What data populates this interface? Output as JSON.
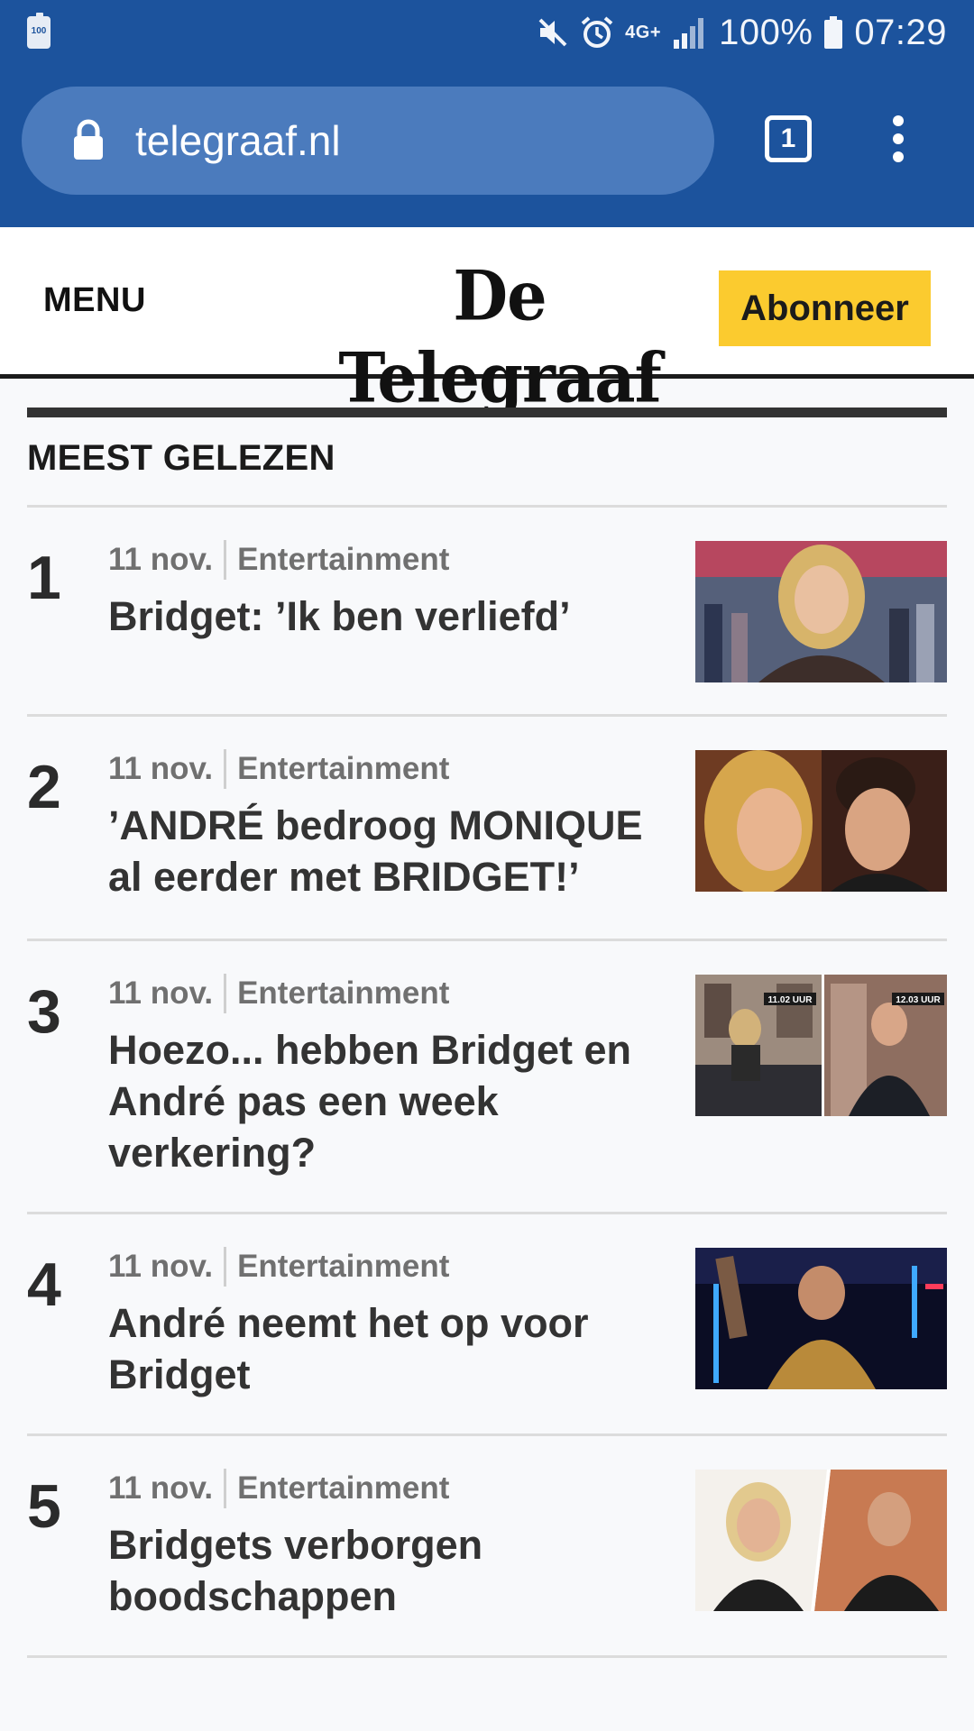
{
  "status_bar": {
    "battery_small": "100",
    "network": "4G+",
    "battery_percent": "100%",
    "time": "07:29"
  },
  "browser": {
    "url": "telegraaf.nl",
    "tab_count": "1"
  },
  "header": {
    "menu_label": "MENU",
    "logo_text": "De Telegraaf",
    "subscribe_label": "Abonneer"
  },
  "section": {
    "title": "MEEST GELEZEN"
  },
  "articles": [
    {
      "rank": "1",
      "date": "11 nov.",
      "category": "Entertainment",
      "headline": "Bridget: ’Ik ben verliefd’"
    },
    {
      "rank": "2",
      "date": "11 nov.",
      "category": "Entertainment",
      "headline": "’ANDRÉ bedroog MONIQUE al eerder met BRIDGET!’"
    },
    {
      "rank": "3",
      "date": "11 nov.",
      "category": "Entertainment",
      "headline": "Hoezo... hebben Bridget en André pas een week verkering?"
    },
    {
      "rank": "4",
      "date": "11 nov.",
      "category": "Entertainment",
      "headline": "André neemt het op voor Bridget"
    },
    {
      "rank": "5",
      "date": "11 nov.",
      "category": "Entertainment",
      "headline": "Bridgets verborgen boodschappen"
    }
  ],
  "thumb3_captions": {
    "left": "11.02 UUR",
    "right": "12.03 UUR"
  },
  "colors": {
    "browser_chrome": "#1c539d",
    "url_bar": "#4b7bbd",
    "subscribe_button": "#fbcb2f",
    "meta_text": "#707070",
    "headline_text": "#333333"
  }
}
